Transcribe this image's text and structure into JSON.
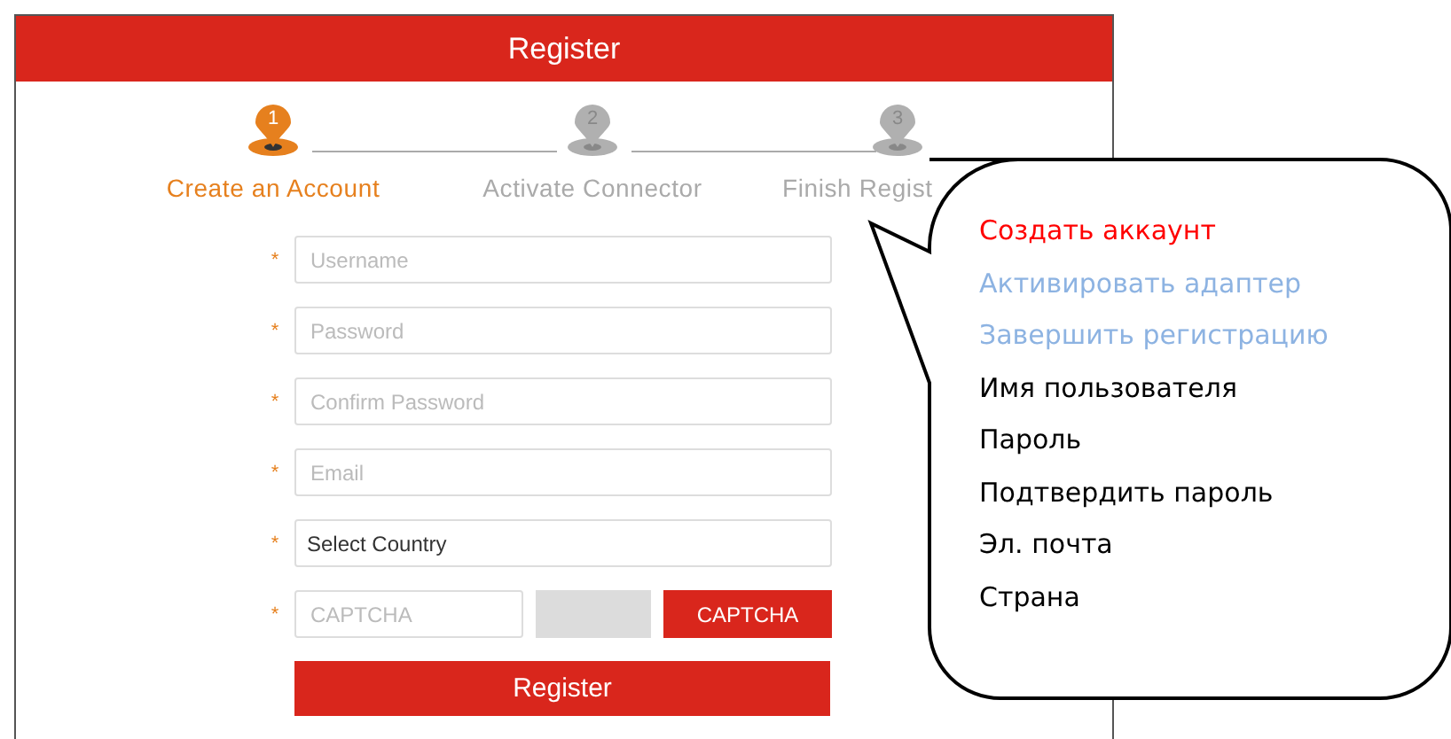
{
  "window": {
    "title": "Register"
  },
  "steps": [
    {
      "number": "1",
      "label": "Create an Account",
      "selected": true
    },
    {
      "number": "2",
      "label": "Activate Connector",
      "selected": false
    },
    {
      "number": "3",
      "label": "Finish Regist",
      "selected": false
    }
  ],
  "fields": [
    {
      "kind": "input",
      "placeholder": "Username",
      "mark": "*"
    },
    {
      "kind": "input",
      "placeholder": "Password",
      "mark": "*"
    },
    {
      "kind": "input",
      "placeholder": "Confirm Password",
      "mark": "*"
    },
    {
      "kind": "input",
      "placeholder": "Email",
      "mark": "*"
    },
    {
      "kind": "select",
      "value": "Select Country",
      "mark": "*"
    }
  ],
  "captcha": {
    "placeholder": "CAPTCHA",
    "mark": "*",
    "button": "CAPTCHA"
  },
  "register_button": "Register",
  "callout": [
    {
      "text": "Создать аккаунт",
      "color": "#ff0000"
    },
    {
      "text": "Активировать адаптер",
      "color": "#8db3e2"
    },
    {
      "text": "Завершить регистрацию",
      "color": "#8db3e2"
    },
    {
      "text": "Имя пользователя",
      "color": "#000000"
    },
    {
      "text": "Пароль",
      "color": "#000000"
    },
    {
      "text": "Подтвердить пароль",
      "color": "#000000"
    },
    {
      "text": "Эл. почта",
      "color": "#000000"
    },
    {
      "text": "Страна",
      "color": "#000000"
    }
  ]
}
